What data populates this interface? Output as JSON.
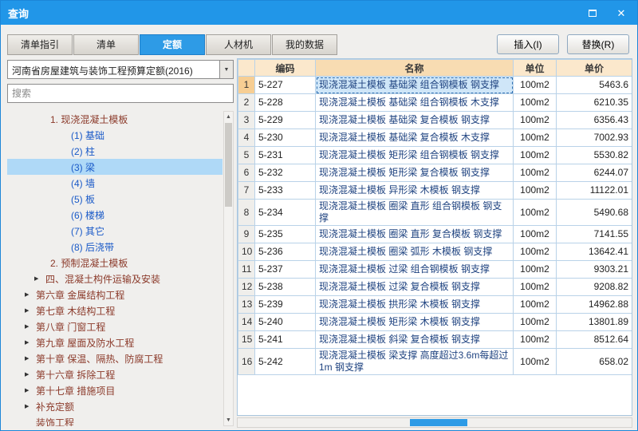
{
  "window": {
    "title": "查询"
  },
  "tabs": [
    {
      "id": "list-guide",
      "label": "清单指引",
      "active": false
    },
    {
      "id": "list",
      "label": "清单",
      "active": false
    },
    {
      "id": "quota",
      "label": "定额",
      "active": true
    },
    {
      "id": "labor-material-machine",
      "label": "人材机",
      "active": false
    },
    {
      "id": "my-data",
      "label": "我的数据",
      "active": false
    }
  ],
  "actions": {
    "insert": "插入(I)",
    "replace": "替换(R)"
  },
  "sidebar": {
    "dropdown_value": "河南省房屋建筑与装饰工程预算定额(2016)",
    "search_placeholder": "搜索",
    "tree": [
      {
        "label": "1. 现浇混凝土模板",
        "level": 2,
        "kind": "parent",
        "arrow": false,
        "selected": false
      },
      {
        "label": "(1) 基础",
        "level": 3,
        "kind": "leaf",
        "arrow": false,
        "selected": false
      },
      {
        "label": "(2) 柱",
        "level": 3,
        "kind": "leaf",
        "arrow": false,
        "selected": false
      },
      {
        "label": "(3) 梁",
        "level": 3,
        "kind": "leaf",
        "arrow": false,
        "selected": true
      },
      {
        "label": "(4) 墙",
        "level": 3,
        "kind": "leaf",
        "arrow": false,
        "selected": false
      },
      {
        "label": "(5) 板",
        "level": 3,
        "kind": "leaf",
        "arrow": false,
        "selected": false
      },
      {
        "label": "(6) 楼梯",
        "level": 3,
        "kind": "leaf",
        "arrow": false,
        "selected": false
      },
      {
        "label": "(7) 其它",
        "level": 3,
        "kind": "leaf",
        "arrow": false,
        "selected": false
      },
      {
        "label": "(8) 后浇带",
        "level": 3,
        "kind": "leaf",
        "arrow": false,
        "selected": false
      },
      {
        "label": "2. 预制混凝土模板",
        "level": 2,
        "kind": "parent",
        "arrow": false,
        "selected": false
      },
      {
        "label": "四、混凝土构件运输及安装",
        "level": 1,
        "kind": "parent",
        "arrow": true,
        "selected": false
      },
      {
        "label": "第六章 金属结构工程",
        "level": 0,
        "kind": "parent",
        "arrow": true,
        "selected": false
      },
      {
        "label": "第七章 木结构工程",
        "level": 0,
        "kind": "parent",
        "arrow": true,
        "selected": false
      },
      {
        "label": "第八章 门窗工程",
        "level": 0,
        "kind": "parent",
        "arrow": true,
        "selected": false
      },
      {
        "label": "第九章 屋面及防水工程",
        "level": 0,
        "kind": "parent",
        "arrow": true,
        "selected": false
      },
      {
        "label": "第十章 保温、隔热、防腐工程",
        "level": 0,
        "kind": "parent",
        "arrow": true,
        "selected": false
      },
      {
        "label": "第十六章 拆除工程",
        "level": 0,
        "kind": "parent",
        "arrow": true,
        "selected": false
      },
      {
        "label": "第十七章 措施项目",
        "level": 0,
        "kind": "parent",
        "arrow": true,
        "selected": false
      },
      {
        "label": "补充定额",
        "level": 0,
        "kind": "parent",
        "arrow": true,
        "selected": false
      },
      {
        "label": "装饰工程",
        "level": 0,
        "kind": "parent",
        "arrow": false,
        "selected": false
      }
    ]
  },
  "table": {
    "headers": {
      "code": "编码",
      "name": "名称",
      "unit": "单位",
      "price": "单价"
    },
    "rows": [
      {
        "num": "1",
        "code": "5-227",
        "name": "现浇混凝土模板 基础梁 组合钢模板 钢支撑",
        "unit": "100m2",
        "price": "5463.6",
        "selected": true
      },
      {
        "num": "2",
        "code": "5-228",
        "name": "现浇混凝土模板 基础梁 组合钢模板 木支撑",
        "unit": "100m2",
        "price": "6210.35",
        "selected": false
      },
      {
        "num": "3",
        "code": "5-229",
        "name": "现浇混凝土模板 基础梁 复合模板 钢支撑",
        "unit": "100m2",
        "price": "6356.43",
        "selected": false
      },
      {
        "num": "4",
        "code": "5-230",
        "name": "现浇混凝土模板 基础梁 复合模板 木支撑",
        "unit": "100m2",
        "price": "7002.93",
        "selected": false
      },
      {
        "num": "5",
        "code": "5-231",
        "name": "现浇混凝土模板 矩形梁 组合钢模板 钢支撑",
        "unit": "100m2",
        "price": "5530.82",
        "selected": false
      },
      {
        "num": "6",
        "code": "5-232",
        "name": "现浇混凝土模板 矩形梁 复合模板 钢支撑",
        "unit": "100m2",
        "price": "6244.07",
        "selected": false
      },
      {
        "num": "7",
        "code": "5-233",
        "name": "现浇混凝土模板 异形梁 木模板 钢支撑",
        "unit": "100m2",
        "price": "11122.01",
        "selected": false
      },
      {
        "num": "8",
        "code": "5-234",
        "name": "现浇混凝土模板 圈梁 直形 组合钢模板 钢支撑",
        "unit": "100m2",
        "price": "5490.68",
        "selected": false
      },
      {
        "num": "9",
        "code": "5-235",
        "name": "现浇混凝土模板 圈梁 直形 复合模板 钢支撑",
        "unit": "100m2",
        "price": "7141.55",
        "selected": false
      },
      {
        "num": "10",
        "code": "5-236",
        "name": "现浇混凝土模板 圈梁 弧形 木模板 钢支撑",
        "unit": "100m2",
        "price": "13642.41",
        "selected": false
      },
      {
        "num": "11",
        "code": "5-237",
        "name": "现浇混凝土模板 过梁 组合钢模板 钢支撑",
        "unit": "100m2",
        "price": "9303.21",
        "selected": false
      },
      {
        "num": "12",
        "code": "5-238",
        "name": "现浇混凝土模板 过梁 复合模板 钢支撑",
        "unit": "100m2",
        "price": "9208.82",
        "selected": false
      },
      {
        "num": "13",
        "code": "5-239",
        "name": "现浇混凝土模板 拱形梁 木模板 钢支撑",
        "unit": "100m2",
        "price": "14962.88",
        "selected": false
      },
      {
        "num": "14",
        "code": "5-240",
        "name": "现浇混凝土模板 矩形梁 木模板 钢支撑",
        "unit": "100m2",
        "price": "13801.89",
        "selected": false
      },
      {
        "num": "15",
        "code": "5-241",
        "name": "现浇混凝土模板 斜梁 复合模板 钢支撑",
        "unit": "100m2",
        "price": "8512.64",
        "selected": false
      },
      {
        "num": "16",
        "code": "5-242",
        "name": "现浇混凝土模板 梁支撑 高度超过3.6m每超过1m 钢支撑",
        "unit": "100m2",
        "price": "658.02",
        "selected": false
      }
    ]
  },
  "colors": {
    "titlebar": "#2196E8",
    "active_tab": "#2E9BE6",
    "header_name_bg": "#F8DCB2",
    "selected_cell_bg": "#CFE6F8",
    "tree_parent_text": "#8B3A2A",
    "tree_leaf_text": "#1A5AC8"
  }
}
